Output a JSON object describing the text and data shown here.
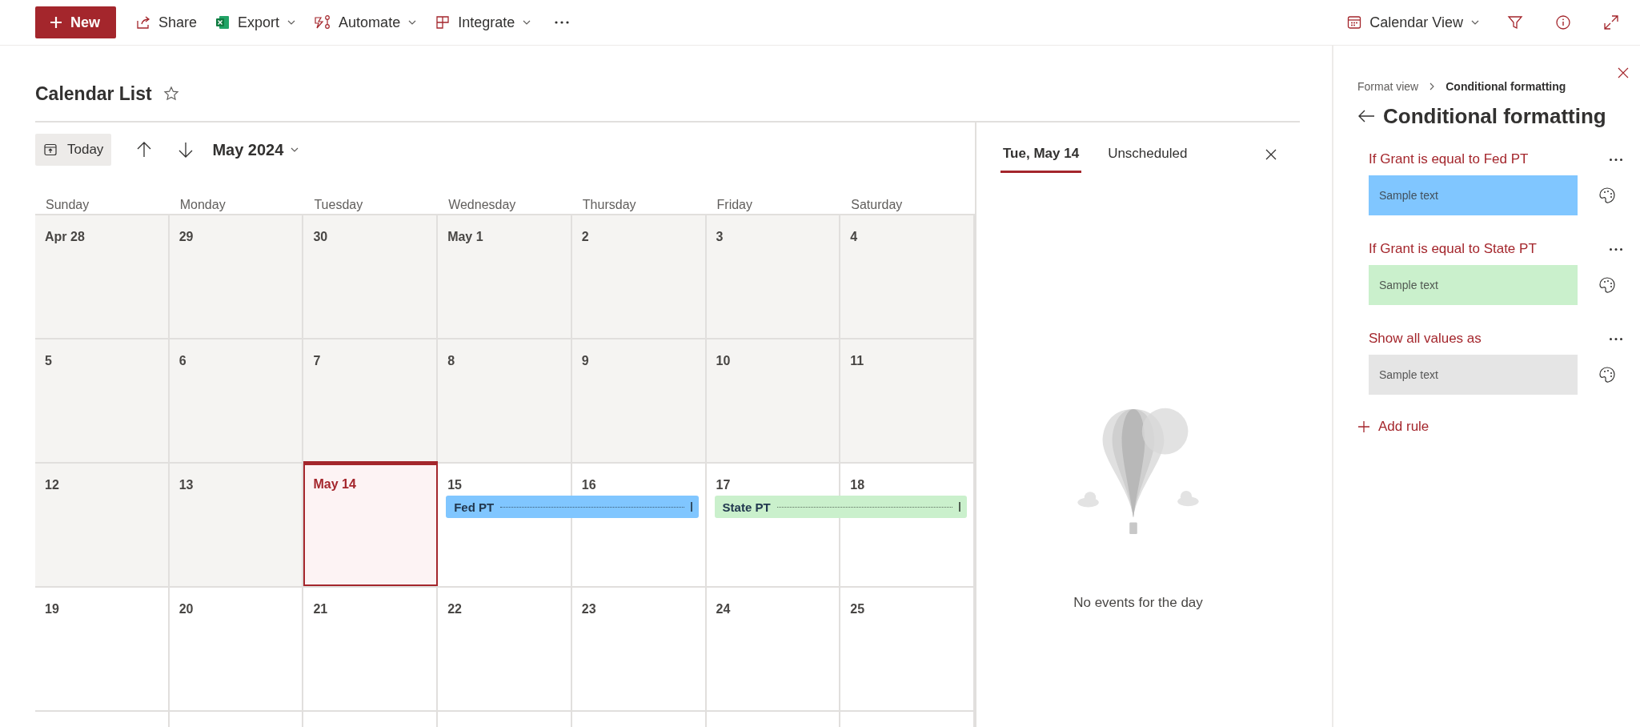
{
  "toolbar": {
    "new_button": "New",
    "items": [
      {
        "kind": "share",
        "label": "Share",
        "dropdown": false
      },
      {
        "kind": "export",
        "label": "Export",
        "dropdown": true
      },
      {
        "kind": "automate",
        "label": "Automate",
        "dropdown": true
      },
      {
        "kind": "integrate",
        "label": "Integrate",
        "dropdown": true
      }
    ],
    "view_switcher": "Calendar View"
  },
  "list_title": "Calendar List",
  "calendar": {
    "today_button": "Today",
    "month": "May 2024",
    "weekdays": [
      "Sunday",
      "Monday",
      "Tuesday",
      "Wednesday",
      "Thursday",
      "Friday",
      "Saturday"
    ],
    "weeks": [
      {
        "days": [
          {
            "label": "Apr 28",
            "past": true,
            "selected": false
          },
          {
            "label": "29",
            "past": true,
            "selected": false
          },
          {
            "label": "30",
            "past": true,
            "selected": false
          },
          {
            "label": "May 1",
            "past": true,
            "selected": false
          },
          {
            "label": "2",
            "past": true,
            "selected": false
          },
          {
            "label": "3",
            "past": true,
            "selected": false
          },
          {
            "label": "4",
            "past": true,
            "selected": false
          }
        ]
      },
      {
        "days": [
          {
            "label": "5",
            "past": true,
            "selected": false
          },
          {
            "label": "6",
            "past": true,
            "selected": false
          },
          {
            "label": "7",
            "past": true,
            "selected": false
          },
          {
            "label": "8",
            "past": true,
            "selected": false
          },
          {
            "label": "9",
            "past": true,
            "selected": false
          },
          {
            "label": "10",
            "past": true,
            "selected": false
          },
          {
            "label": "11",
            "past": true,
            "selected": false
          }
        ]
      },
      {
        "days": [
          {
            "label": "12",
            "past": true,
            "selected": false
          },
          {
            "label": "13",
            "past": true,
            "selected": false
          },
          {
            "label": "May 14",
            "past": false,
            "selected": true
          },
          {
            "label": "15",
            "past": false,
            "selected": false,
            "event": {
              "title": "Fed PT",
              "color": "#80c6ff"
            }
          },
          {
            "label": "16",
            "past": false,
            "selected": false,
            "event_end": true
          },
          {
            "label": "17",
            "past": false,
            "selected": false,
            "event": {
              "title": "State PT",
              "color": "#caf0cc"
            }
          },
          {
            "label": "18",
            "past": false,
            "selected": false,
            "event_end": true
          }
        ]
      },
      {
        "days": [
          {
            "label": "19",
            "past": false,
            "selected": false
          },
          {
            "label": "20",
            "past": false,
            "selected": false
          },
          {
            "label": "21",
            "past": false,
            "selected": false
          },
          {
            "label": "22",
            "past": false,
            "selected": false
          },
          {
            "label": "23",
            "past": false,
            "selected": false
          },
          {
            "label": "24",
            "past": false,
            "selected": false
          },
          {
            "label": "25",
            "past": false,
            "selected": false
          }
        ]
      }
    ]
  },
  "day_panel": {
    "tabs": [
      {
        "label": "Tue, May 14",
        "selected": true
      },
      {
        "label": "Unscheduled",
        "selected": false
      }
    ],
    "empty_message": "No events for the day"
  },
  "format_panel": {
    "breadcrumb": [
      "Format view",
      "Conditional formatting"
    ],
    "title": "Conditional formatting",
    "rules": [
      {
        "condition": "If Grant is equal to Fed PT",
        "sample": "Sample text",
        "color": "#80c6ff"
      },
      {
        "condition": "If Grant is equal to State PT",
        "sample": "Sample text",
        "color": "#caf0cc"
      },
      {
        "condition": "Show all values as",
        "sample": "Sample text",
        "color": "#e5e5e5"
      }
    ],
    "add_rule": "Add rule"
  }
}
